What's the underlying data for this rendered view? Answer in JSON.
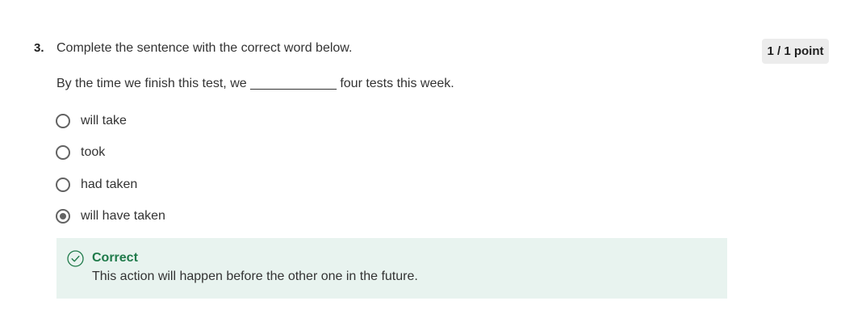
{
  "question": {
    "number": "3.",
    "prompt": "Complete the sentence with the correct word below.",
    "points": "1 / 1 point",
    "sentence": "By the time we finish this test, we ____________ four tests this week."
  },
  "options": [
    {
      "label": "will take",
      "selected": false
    },
    {
      "label": "took",
      "selected": false
    },
    {
      "label": "had taken",
      "selected": false
    },
    {
      "label": "will have taken",
      "selected": true
    }
  ],
  "feedback": {
    "icon": "check-circle-icon",
    "title": "Correct",
    "text": "This action will happen before the other one in the future.",
    "color": "#1f7a4a",
    "background": "#e8f3ef"
  }
}
